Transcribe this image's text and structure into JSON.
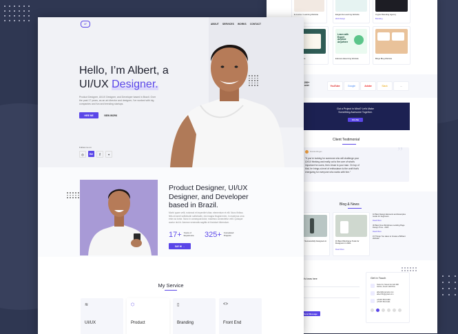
{
  "front": {
    "logo": "AF",
    "nav": [
      "ABOUT",
      "SERVICES",
      "WORKS",
      "CONTACT"
    ],
    "hero": {
      "line1": "Hello, I’m Albert, a",
      "line2": "UI/UX ",
      "highlight": "Designer.",
      "desc1": "Product Designer, UI/UX Designer, and Developer based in Brazil. Over",
      "desc2": "the past 17 years, as an art director and designer, I've worked with big",
      "desc3": "companies and fun and trending startups.",
      "hire_btn": "HIRE ME",
      "work_btn": "VIEW WORK",
      "follow": "Follow me on"
    },
    "about": {
      "title1": "Product Designer, UI/UX",
      "title2": "Designer, and Developer",
      "title3": "based in Brazil.",
      "p1": "Morbi quam velit, euismod et imperdiet vitae, elementum et elit. Nunc finibus",
      "p2": "felis sit amet sollicitudin sollicitudin, nisl magna feugiat enim, in maximus urna",
      "p3": "enim ac tortor. Nunc in consequat dolor, maximus consectetur velit. Quisque",
      "p4": "auctor nisl id. Aenean venenatis sagittis et tincidunt bibendum.",
      "stat1_num": "17+",
      "stat1_label1": "Years of",
      "stat1_label2": "Experience",
      "stat2_num": "325+",
      "stat2_label1": "Completed",
      "stat2_label2": "Projects",
      "say_hi": "SAY HI →"
    },
    "services": {
      "title": "My Service",
      "items": [
        {
          "icon": "layers-icon",
          "label": "UI/UX"
        },
        {
          "icon": "box-icon",
          "label": "Product"
        },
        {
          "icon": "book-icon",
          "label": "Branding"
        },
        {
          "icon": "code-icon",
          "label": "Front End"
        }
      ]
    }
  },
  "back": {
    "works_row1": [
      "E-course / Learning Website",
      "Elegant E-Learning Website",
      "Crypto Branding Agency"
    ],
    "works_row1_tags": [
      "Web Design",
      "Web Design",
      "Branding"
    ],
    "works_row2": [
      "Blog Website",
      "Educare Elearning Website",
      "Blogs Blog Website"
    ],
    "thumb_text": "Learn with Expert Anytime Anywhere",
    "clients": [
      "YouTube",
      "Google",
      "Adobe",
      "Slack"
    ],
    "client_more": "...",
    "clients_heading1": "d with 200+",
    "clients_heading2": "ers all over",
    "clients_heading3": "d.",
    "cta_line1": "Got a Project in Mind? Let’s Make",
    "cta_line2": "Something Awesome Together.",
    "cta_btn": "Hire Me",
    "testimonial_title": "Client Testimonial",
    "testimonial_name": "Florida Morgan",
    "testimonial_quote1": "\"If you're looking for someone who will challenge your",
    "testimonial_quote2": "UX/UI thinking and really cut to the core of what's",
    "testimonial_quote3": "important for users, then Jesse is your man. On top of",
    "testimonial_quote4": "that, he brings a level of enthusiasm to the craft that's",
    "testimonial_quote5": "energizing for everyone who works with him.\"",
    "blog_title": "Blog & News",
    "blog_posts": [
      "Tools for Successfully Designers in 2021",
      "15 Best Wireframe Tools for Designers in 2021"
    ],
    "blog_side": [
      "10 Best Design Elements and Examples Guide for beginners",
      "30 Best Free Wordpress Landing Page Design Time - 2021",
      "15 Things You Have to Create a Brilliant Website"
    ],
    "read_more": "Read More",
    "contact_left": "Let's know here",
    "contact_title": "Get in Touch",
    "contact_lines": [
      "Suite 34, Street No 22A Mill",
      "Oshiro, Fresh 100 PKA",
      "albert@example.com",
      "albert.fin@gmail.com",
      "+8 987 653 3459",
      "+8 987 654 3421"
    ],
    "send": "Send Message"
  },
  "colors": {
    "accent": "#5a46e8",
    "dark_bg": "#2f3752",
    "cta_bg": "#1c2152"
  }
}
